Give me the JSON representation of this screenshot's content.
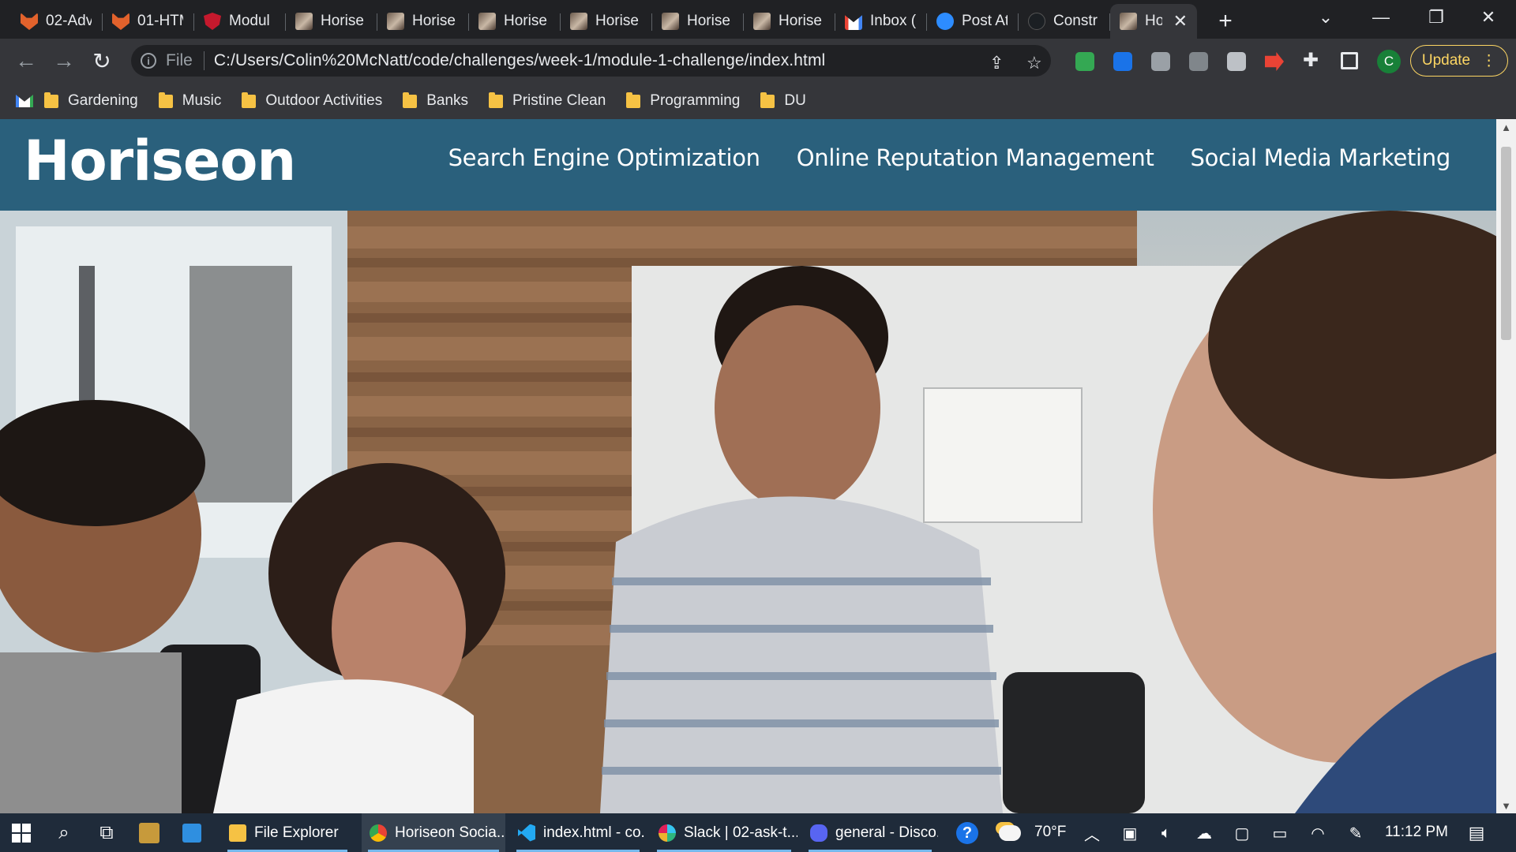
{
  "browser": {
    "tabs": [
      {
        "title": "02-Adv",
        "icon": "gitlab-fox-icon"
      },
      {
        "title": "01-HTM",
        "icon": "gitlab-fox-icon"
      },
      {
        "title": "Modul",
        "icon": "shield-icon"
      },
      {
        "title": "Horise",
        "icon": "photo-favicon-icon"
      },
      {
        "title": "Horise",
        "icon": "photo-favicon-icon"
      },
      {
        "title": "Horise",
        "icon": "photo-favicon-icon"
      },
      {
        "title": "Horise",
        "icon": "photo-favicon-icon"
      },
      {
        "title": "Horise",
        "icon": "photo-favicon-icon"
      },
      {
        "title": "Horise",
        "icon": "photo-favicon-icon"
      },
      {
        "title": "Inbox (",
        "icon": "gmail-icon"
      },
      {
        "title": "Post At",
        "icon": "zoom-icon"
      },
      {
        "title": "Constr",
        "icon": "github-icon"
      },
      {
        "title": "Ho",
        "icon": "photo-favicon-icon",
        "active": true
      }
    ],
    "address": {
      "scheme_label": "File",
      "url": "C:/Users/Colin%20McNatt/code/challenges/week-1/module-1-challenge/index.html"
    },
    "profile_initial": "C",
    "update_label": "Update",
    "bookmarks": [
      "Gardening",
      "Music",
      "Outdoor Activities",
      "Banks",
      "Pristine Clean",
      "Programming",
      "DU"
    ]
  },
  "site": {
    "logo": "Horiseon",
    "nav": [
      "Search Engine Optimization",
      "Online Reputation Management",
      "Social Media Marketing"
    ]
  },
  "taskbar": {
    "apps": [
      {
        "label": "File Explorer",
        "icon": "folder-icon",
        "active": false
      },
      {
        "label": "Horiseon Socia...",
        "icon": "chrome-icon",
        "active": true
      },
      {
        "label": "index.html - co...",
        "icon": "vscode-icon",
        "active": false
      },
      {
        "label": "Slack | 02-ask-t...",
        "icon": "slack-icon",
        "active": false
      },
      {
        "label": "general - Disco...",
        "icon": "discord-icon",
        "active": false
      }
    ],
    "weather": "70°F",
    "time": "11:12 PM"
  },
  "colors": {
    "site_header": "#2a607c",
    "chrome_dark": "#202124",
    "chrome_toolbar": "#35363a",
    "update_accent": "#fdd663",
    "taskbar": "#1f2b3a"
  }
}
